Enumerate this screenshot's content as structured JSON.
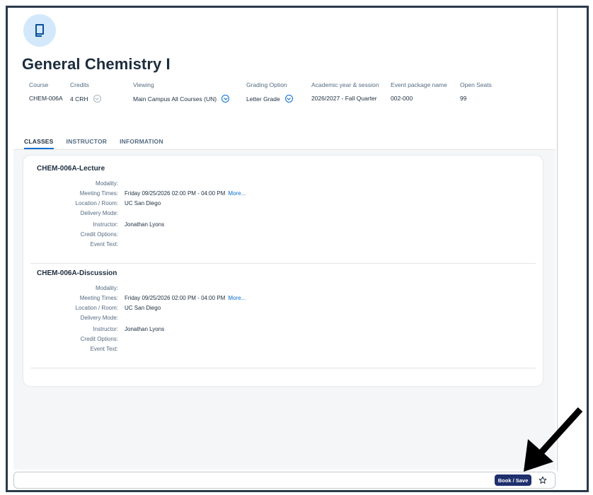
{
  "course": {
    "title": "General Chemistry I",
    "fields": [
      {
        "label": "Course",
        "value": "CHEM-006A"
      },
      {
        "label": "Credits",
        "value": "4 CRH"
      },
      {
        "label": "Viewing",
        "value": "Main Campus All Courses (UN)"
      },
      {
        "label": "Grading Option",
        "value": "Letter Grade"
      },
      {
        "label": "Academic year & session",
        "value": "2026/2027 - Fall Quarter"
      },
      {
        "label": "Event package name",
        "value": "002-000"
      },
      {
        "label": "Open Seats",
        "value": "99"
      }
    ]
  },
  "tabs": [
    "CLASSES",
    "INSTRUCTOR",
    "INFORMATION"
  ],
  "active_tab": "CLASSES",
  "classes": [
    {
      "name": "CHEM-006A-Lecture",
      "rows": [
        {
          "label": "Modality:",
          "value": ""
        },
        {
          "label": "Meeting Times:",
          "value": "Friday 09/25/2026  02:00 PM - 04:00 PM",
          "link": "More..."
        },
        {
          "label": "Location / Room:",
          "value": "UC San Diego"
        },
        {
          "label": "Delivery Mode:",
          "value": ""
        },
        {
          "label": "Instructor:",
          "value": "Jonathan Lyons"
        },
        {
          "label": "Credit Options:",
          "value": ""
        },
        {
          "label": "Event Text:",
          "value": ""
        }
      ]
    },
    {
      "name": "CHEM-006A-Discussion",
      "rows": [
        {
          "label": "Modality:",
          "value": ""
        },
        {
          "label": "Meeting Times:",
          "value": "Friday 09/25/2026  02:00 PM - 04:00 PM",
          "link": "More..."
        },
        {
          "label": "Location / Room:",
          "value": "UC San Diego"
        },
        {
          "label": "Delivery Mode:",
          "value": ""
        },
        {
          "label": "Instructor:",
          "value": "Jonathan Lyons"
        },
        {
          "label": "Credit Options:",
          "value": ""
        },
        {
          "label": "Event Text:",
          "value": ""
        }
      ]
    }
  ],
  "footer": {
    "book_label": "Book / Save"
  },
  "icons": {
    "header": "book-icon",
    "star": "star-icon",
    "dropdown": "chevron-down-icon",
    "annotation": "arrow-icon"
  },
  "colors": {
    "accent": "#0a6ed1",
    "button": "#1f2f6d",
    "icon_bg": "#d3e8fb"
  }
}
